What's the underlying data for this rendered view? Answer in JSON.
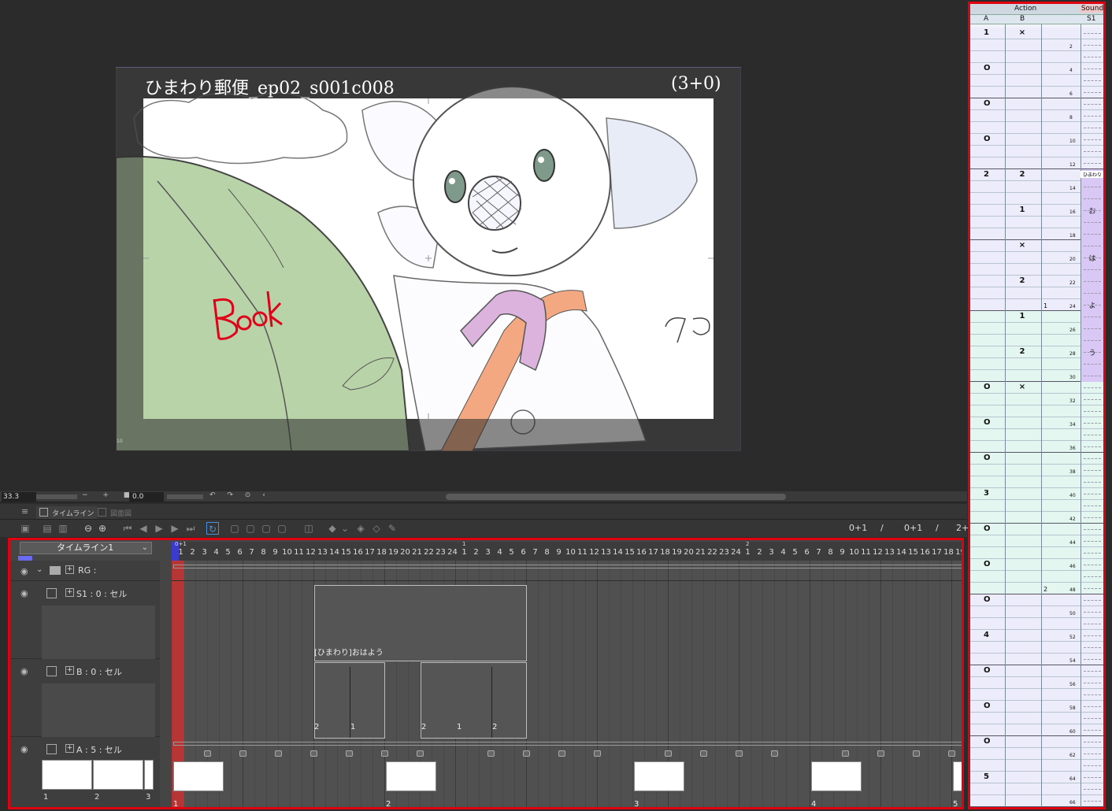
{
  "canvas": {
    "title": "ひまわり郵便_ep02_s001c008",
    "count": "(3+0)",
    "handwriting": "Book",
    "corner_mark": "10"
  },
  "strip": {
    "zoom": "33.3",
    "zoom_controls": "− + ■",
    "angle": "0.0",
    "rotate_controls": "↶ ↷ ⊙ ‹"
  },
  "tabs": {
    "menu": "≡",
    "timeline": "タイムライン",
    "second": "図面図"
  },
  "toolbar": {
    "counter1": "0+1",
    "sep1": "/",
    "counter2": "0+1",
    "sep2": "/",
    "counter3": "2+"
  },
  "timeline": {
    "name": "タイムライン1",
    "ruler_top_marks": [
      "0+1",
      "1",
      "2"
    ],
    "ruler_numbers": [
      "1",
      "2",
      "3",
      "4",
      "5",
      "6",
      "7",
      "8",
      "9",
      "10",
      "11",
      "12",
      "13",
      "14",
      "15",
      "16",
      "17",
      "18",
      "19",
      "20",
      "21",
      "22",
      "23",
      "24",
      "1",
      "2",
      "3",
      "4",
      "5",
      "6",
      "7",
      "8",
      "9",
      "10",
      "11",
      "12",
      "13",
      "14",
      "15",
      "16",
      "17",
      "18",
      "19",
      "20",
      "21",
      "22",
      "23",
      "24",
      "1",
      "2",
      "3",
      "4",
      "5",
      "6",
      "7",
      "8",
      "9",
      "10",
      "11",
      "12",
      "13",
      "14",
      "15",
      "16",
      "17",
      "18",
      "19"
    ],
    "layers": {
      "rg": "RG :",
      "s1": "S1 : 0 : セル",
      "b": "B : 0 : セル",
      "a": "A : 5 : セル"
    },
    "s1_cel_label": "[ひまわり]おはよう",
    "b_cel_labels": [
      "2",
      "1",
      "2",
      "1",
      "2"
    ],
    "a_thumb_labels": [
      "1",
      "2",
      "3"
    ],
    "a_frame_labels": [
      "1",
      "2",
      "3",
      "4",
      "5"
    ]
  },
  "xsheet": {
    "header_action": "Action",
    "header_sound": "Sound",
    "col_a": "A",
    "col_b": "B",
    "col_s": "S1",
    "a_cells": [
      {
        "row": 0,
        "v": "1"
      },
      {
        "row": 3,
        "v": "O"
      },
      {
        "row": 6,
        "v": "O"
      },
      {
        "row": 9,
        "v": "O"
      },
      {
        "row": 12,
        "v": "2"
      },
      {
        "row": 30,
        "v": "O"
      },
      {
        "row": 33,
        "v": "O"
      },
      {
        "row": 36,
        "v": "O"
      },
      {
        "row": 39,
        "v": "3"
      },
      {
        "row": 42,
        "v": "O"
      },
      {
        "row": 45,
        "v": "O"
      },
      {
        "row": 48,
        "v": "O"
      },
      {
        "row": 51,
        "v": "4"
      },
      {
        "row": 54,
        "v": "O"
      },
      {
        "row": 57,
        "v": "O"
      },
      {
        "row": 60,
        "v": "O"
      },
      {
        "row": 63,
        "v": "5"
      }
    ],
    "b_cells": [
      {
        "row": 0,
        "v": "×"
      },
      {
        "row": 12,
        "v": "2"
      },
      {
        "row": 15,
        "v": "1"
      },
      {
        "row": 18,
        "v": "×"
      },
      {
        "row": 21,
        "v": "2"
      },
      {
        "row": 24,
        "v": "1"
      },
      {
        "row": 27,
        "v": "2"
      },
      {
        "row": 30,
        "v": "×"
      }
    ],
    "frame_numbers": [
      "2",
      "4",
      "6",
      "8",
      "10",
      "12",
      "14",
      "16",
      "18",
      "20",
      "22",
      "24",
      "26",
      "28",
      "30",
      "32",
      "34",
      "36",
      "38",
      "40",
      "42",
      "44",
      "46",
      "48",
      "50",
      "52",
      "54",
      "56",
      "58",
      "60",
      "62",
      "64",
      "66"
    ],
    "sheet_marks": [
      "1",
      "2"
    ],
    "sound_cells": [
      "ひまわり",
      "お",
      "は",
      "よ",
      "う"
    ]
  },
  "colors": {
    "accent_red": "#e00010",
    "sheet_lavender": "#ececfa",
    "sheet_mint": "#e4f6f0",
    "sound_purple": "#d9c8f5"
  }
}
